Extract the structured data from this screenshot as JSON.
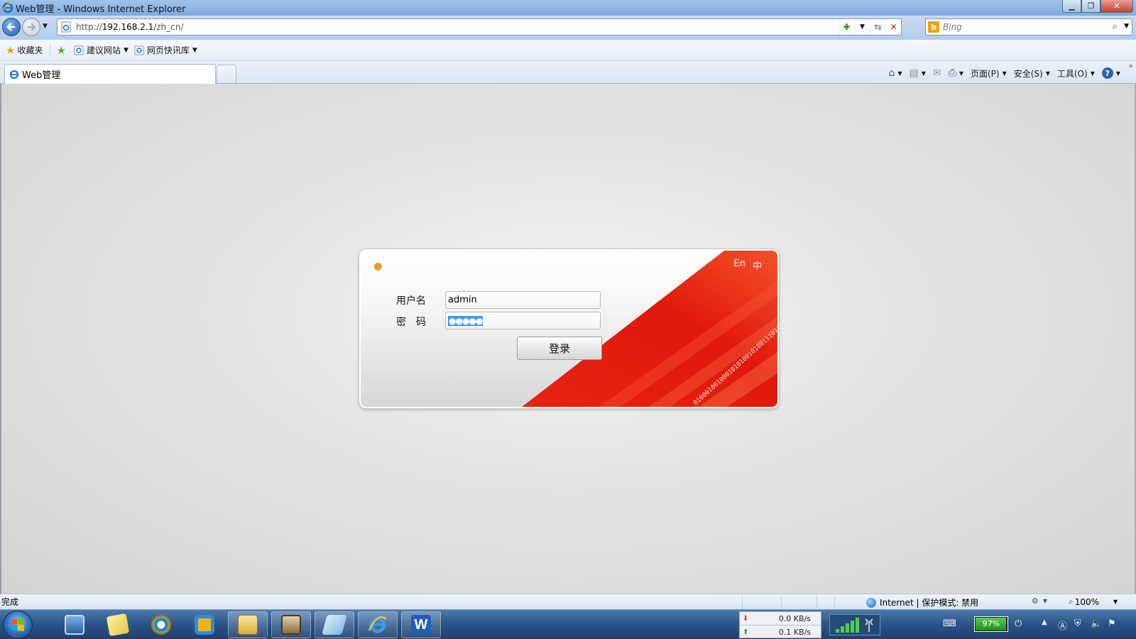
{
  "window": {
    "title": "Web管理 - Windows Internet Explorer",
    "minimize": "▁",
    "restore": "❐",
    "close": "✕"
  },
  "address": {
    "url_prefix": "http://",
    "url_host": "192.168.2.1",
    "url_path": "/zh_cn/",
    "search_placeholder": "Bing"
  },
  "favorites_bar": {
    "favorites_label": "收藏夹",
    "items": [
      {
        "label": "建议网站"
      },
      {
        "label": "网页快讯库"
      }
    ]
  },
  "tabs": [
    {
      "label": "Web管理"
    }
  ],
  "command_bar": {
    "page": "页面(P)",
    "safety": "安全(S)",
    "tools": "工具(O)",
    "help": "?"
  },
  "login": {
    "lang_en": "En",
    "lang_zh": "中",
    "username_label": "用户名",
    "password_label": "密　码",
    "username_value": "admin",
    "password_mask": "●●●●●",
    "submit_label": "登录",
    "binary_text": "0100010010001010100101001110110100001011",
    "colors": {
      "red_primary": "#e8230f",
      "red_light": "#f4512a",
      "dot": "#e99a2c"
    }
  },
  "status_bar": {
    "status": "完成",
    "zone": "Internet | 保护模式: 禁用",
    "zoom": "100%"
  },
  "taskbar": {
    "download_speed": "0.0 KB/s",
    "upload_speed": "0.1 KB/s",
    "battery": "97%",
    "apps": [
      {
        "icon": "computer-icon"
      },
      {
        "icon": "folder-notes-icon"
      },
      {
        "icon": "browser-circle-icon"
      },
      {
        "icon": "app-frame-icon"
      },
      {
        "icon": "file-explorer-icon"
      },
      {
        "icon": "archive-icon"
      },
      {
        "icon": "notepad-icon"
      },
      {
        "icon": "internet-explorer-icon"
      },
      {
        "icon": "wps-writer-icon"
      }
    ]
  }
}
